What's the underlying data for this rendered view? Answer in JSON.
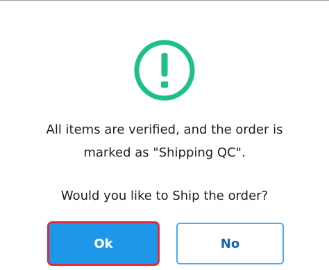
{
  "dialog": {
    "icon": "exclamation-circle-icon",
    "icon_color": "#1dbf8a",
    "message_line1": "All items are verified, and the order is",
    "message_line2": "marked as \"Shipping QC\".",
    "question": "Would you like to Ship the order?",
    "ok_label": "Ok",
    "no_label": "No"
  },
  "colors": {
    "ok_button": "#1e97e8",
    "ok_focus_outline": "#e02a3d",
    "no_button_border": "#4aa9ee",
    "no_button_text": "#1a5fb4"
  }
}
